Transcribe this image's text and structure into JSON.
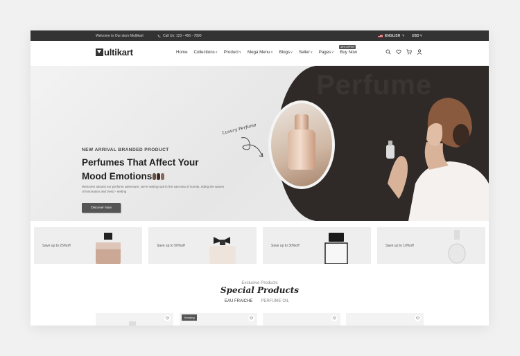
{
  "topbar": {
    "welcome": "Welcome to Our store Multikart",
    "call": "Call Us: 123 - 456 - 7890",
    "language": "ENGLISH",
    "currency": "USD"
  },
  "header": {
    "logo_rest": "ultikart",
    "nav": [
      "Home",
      "Collections",
      "Product",
      "Mega Menu",
      "Blogs",
      "Seller",
      "Pages",
      "Buy Now"
    ],
    "buy_now_badge": "50% OFFER"
  },
  "hero": {
    "bg_word": "Perfume",
    "luxury": "Luxury Perfume",
    "eyebrow": "NEW ARRIVAL BRANDED PRODUCT",
    "title_line1": "Perfumes That Affect Your",
    "title_line2": "Mood Emotions",
    "description": "Welcome aboard our perfume adventure, we're setting sail in the vast sea of scents, riding the waves of innovation and trend - setting",
    "cta": "Discover Now"
  },
  "promos": [
    {
      "text": "Save up to 25%off"
    },
    {
      "text": "Save up to 50%off"
    },
    {
      "text": "Save up to 30%off"
    },
    {
      "text": "Save up to 10%off"
    }
  ],
  "products": {
    "subtitle": "Exclusive Products",
    "title": "Special Products",
    "tabs": [
      "EAU FRAICHE",
      "PERFUME OIL"
    ],
    "trending_label": "Trending"
  },
  "colors": {
    "dark": "#333333",
    "hero_dark": "#2f2a28",
    "accent_button": "#555555"
  }
}
